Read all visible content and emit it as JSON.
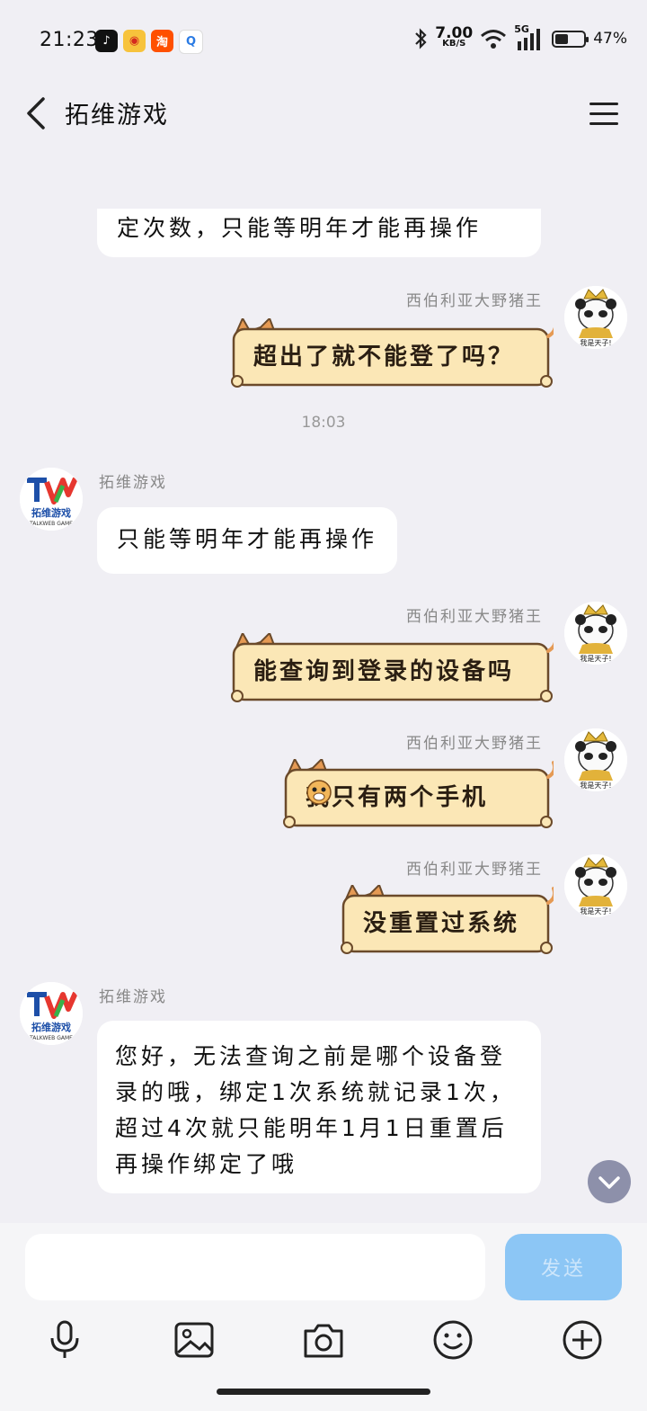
{
  "status": {
    "time": "21:23",
    "speed_value": "7.00",
    "speed_unit": "KB/S",
    "network": "5G",
    "battery": "47%",
    "battery_level": 0.47,
    "app_icons": [
      "tiktok-icon",
      "weibo-icon",
      "taobao-icon",
      "browser-icon"
    ]
  },
  "header": {
    "title": "拓维游戏",
    "back_icon": "chevron-left-icon",
    "menu_icon": "hamburger-menu-icon"
  },
  "messages": {
    "m0_text": "定次数，只能等明年才能再操作",
    "m1_sender": "西伯利亚大野猪王",
    "m1_text": "超出了就不能登了吗？",
    "timestamp": "18:03",
    "m2_sender": "拓维游戏",
    "m2_text": "只能等明年才能再操作",
    "m3_sender": "西伯利亚大野猪王",
    "m3_text": "能查询到登录的设备吗",
    "m4_sender": "西伯利亚大野猪王",
    "m4_text": "我只有两个手机",
    "m5_sender": "西伯利亚大野猪王",
    "m5_text": "没重置过系统",
    "m6_sender": "拓维游戏",
    "m6_text": "您好，无法查询之前是哪个设备登录的哦，绑定1次系统就记录1次，超过4次就只能明年1月1日重置后再操作绑定了哦"
  },
  "avatars": {
    "user_caption": "我是天子!",
    "brand_name": "拓维游戏",
    "brand_sub": "TALKWEB GAME"
  },
  "composer": {
    "send_label": "发送",
    "tools": [
      "microphone-icon",
      "image-icon",
      "camera-icon",
      "emoji-icon",
      "plus-icon"
    ]
  },
  "colors": {
    "page_bg": "#f0eff4",
    "cat_bubble_fill": "#fbe7b6",
    "cat_bubble_stroke": "#6b4a2a",
    "cat_ear": "#e59a54",
    "send_bg": "#8cc6f5"
  }
}
